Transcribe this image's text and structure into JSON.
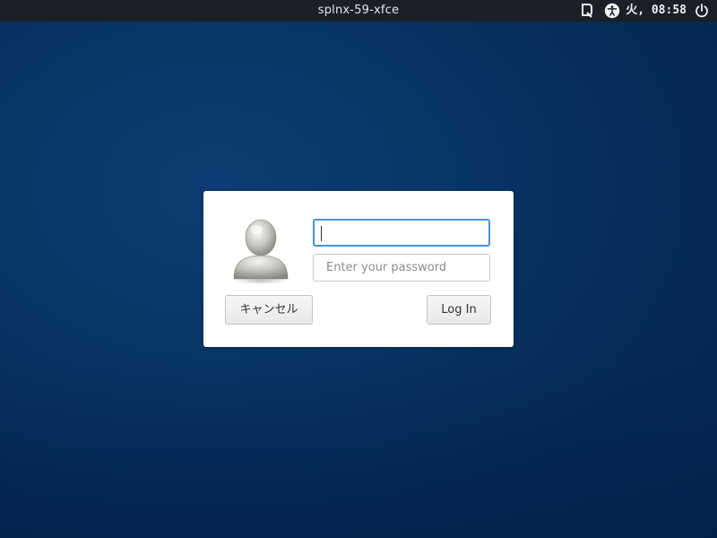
{
  "topbar": {
    "hostname": "splnx-59-xfce",
    "clock": "火, 08:58",
    "icons": [
      "desktop-q-icon",
      "accessibility-icon",
      "power-icon"
    ]
  },
  "login_dialog": {
    "username": {
      "value": "",
      "placeholder": ""
    },
    "password": {
      "value": "",
      "placeholder": "Enter your password"
    },
    "cancel_label": "キャンセル",
    "login_label": "Log In",
    "avatar_icon": "user-avatar-icon"
  },
  "colors": {
    "topbar_bg": "#1c1f26",
    "desktop_bg": "#073565",
    "focus_border": "#4a90d9"
  }
}
